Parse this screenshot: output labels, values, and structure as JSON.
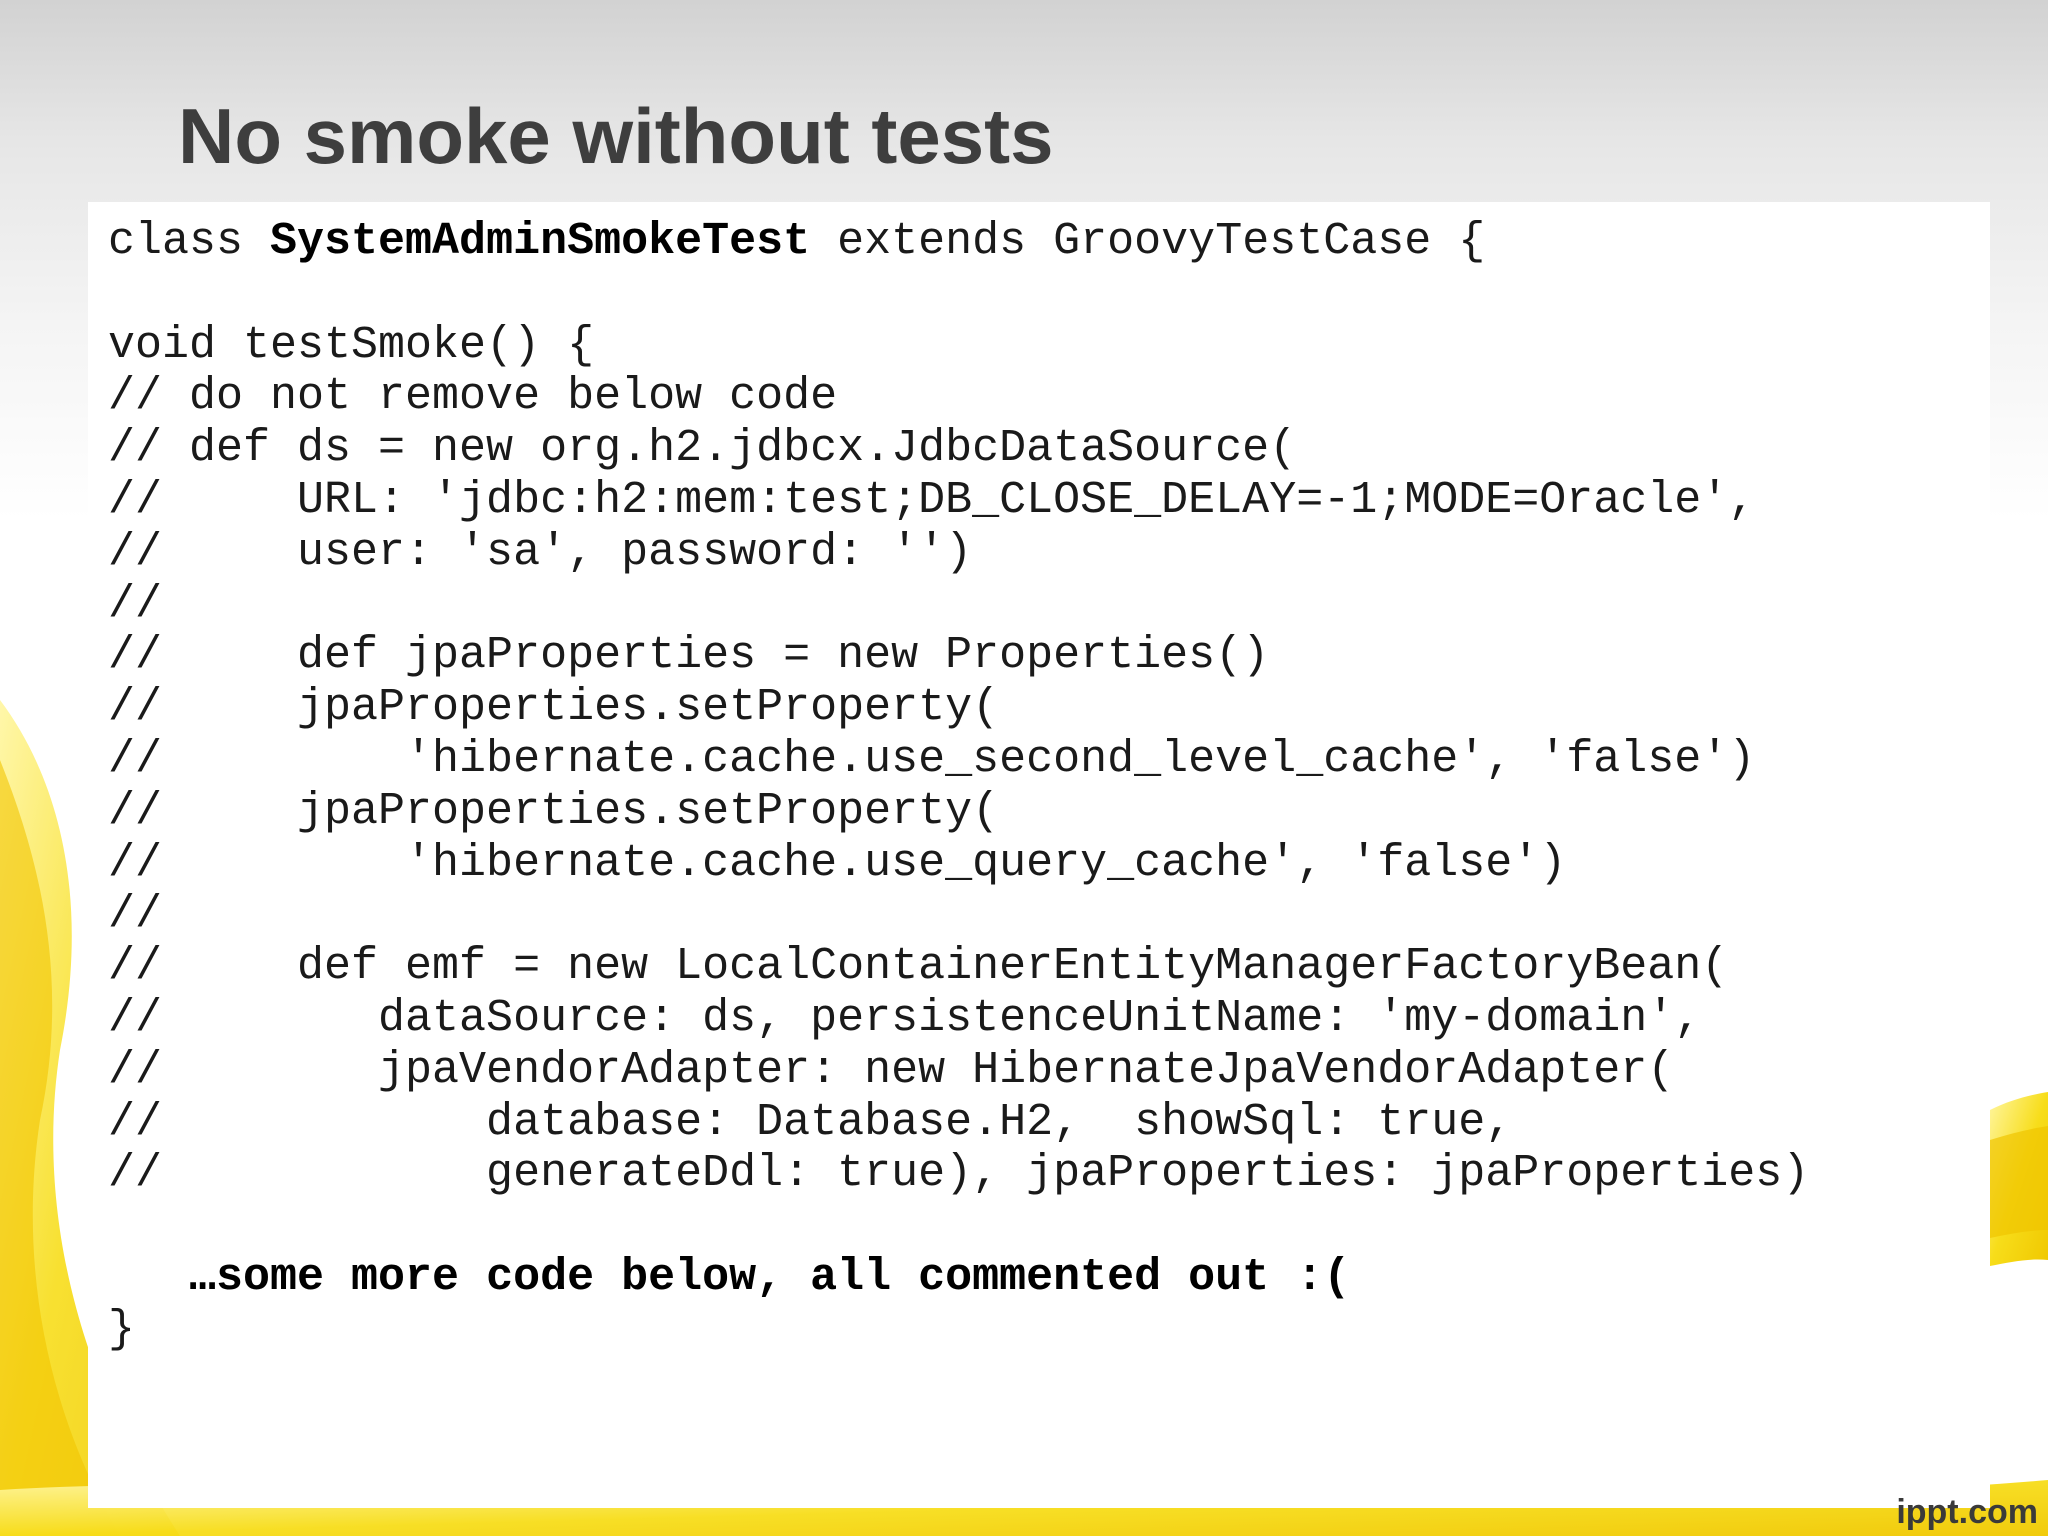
{
  "slide": {
    "title": "No smoke without tests",
    "watermark": "ippt.com"
  },
  "code": {
    "line_01_pre": "class ",
    "line_01_bold": "SystemAdminSmokeTest",
    "line_01_post": " extends GroovyTestCase {",
    "line_02": "",
    "line_03": "void testSmoke() {",
    "line_04": "// do not remove below code",
    "line_05": "// def ds = new org.h2.jdbcx.JdbcDataSource(",
    "line_06": "//     URL: 'jdbc:h2:mem:test;DB_CLOSE_DELAY=-1;MODE=Oracle',",
    "line_07": "//     user: 'sa', password: '')",
    "line_08": "//",
    "line_09": "//     def jpaProperties = new Properties()",
    "line_10": "//     jpaProperties.setProperty(",
    "line_11": "//         'hibernate.cache.use_second_level_cache', 'false')",
    "line_12": "//     jpaProperties.setProperty(",
    "line_13": "//         'hibernate.cache.use_query_cache', 'false')",
    "line_14": "//",
    "line_15": "//     def emf = new LocalContainerEntityManagerFactoryBean(",
    "line_16": "//        dataSource: ds, persistenceUnitName: 'my-domain',",
    "line_17": "//        jpaVendorAdapter: new HibernateJpaVendorAdapter(",
    "line_18": "//            database: Database.H2,  showSql: true,",
    "line_19": "//            generateDdl: true), jpaProperties: jpaProperties)",
    "line_20": "",
    "line_21_indent": "   ",
    "line_21_note": "…some more code below, all commented out :(",
    "line_22": "}"
  },
  "colors": {
    "title": "#3e3e3e",
    "code_text": "#1a1a1a",
    "panel_background": "#ffffff",
    "decor_yellow": "#f5d800"
  }
}
